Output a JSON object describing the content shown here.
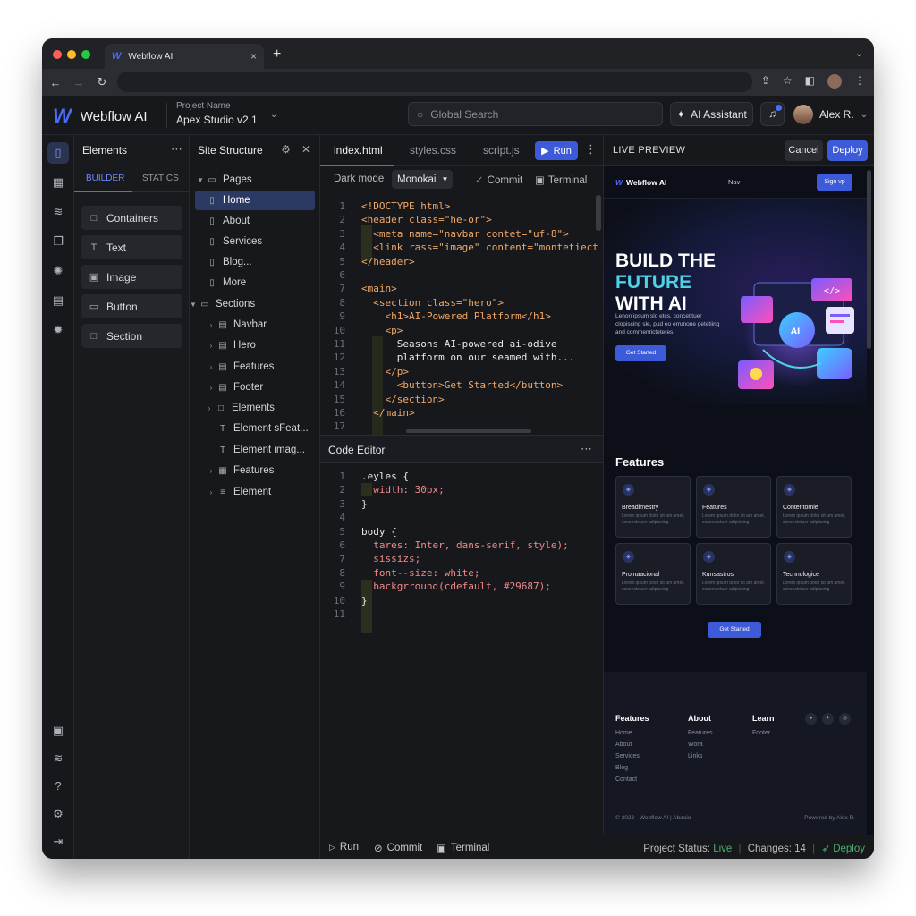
{
  "browser": {
    "tab_title": "Webflow AI",
    "tab_logo": "W",
    "tab_close": "×",
    "new_tab": "+"
  },
  "header": {
    "logo": "W",
    "app_name": "Webflow AI",
    "project_label": "Project Name",
    "project_name": "Apex Studio v2.1",
    "search_placeholder": "Global Search",
    "ai_assistant": "AI Assistant",
    "user_name": "Alex R."
  },
  "elements_panel": {
    "title": "Elements",
    "tabs": [
      "BUILDER",
      "STATICS"
    ],
    "items": [
      {
        "label": "Containers",
        "icon": "□"
      },
      {
        "label": "Text",
        "icon": "T"
      },
      {
        "label": "Image",
        "icon": "▣"
      },
      {
        "label": "Button",
        "icon": "▭"
      },
      {
        "label": "Section",
        "icon": "□"
      }
    ]
  },
  "site_structure": {
    "title": "Site Structure",
    "pages_label": "Pages",
    "pages": [
      "Home",
      "About",
      "Services",
      "Blog...",
      "More"
    ],
    "sections_label": "Sections",
    "sections": [
      "Navbar",
      "Hero",
      "Features",
      "Footer",
      "Elements",
      "Element sFeat...",
      "Element imag...",
      "Features",
      "Element"
    ]
  },
  "editor": {
    "tabs": [
      "index.html",
      "styles.css",
      "script.js"
    ],
    "run": "Run",
    "dark_mode": "Dark mode",
    "theme": "Monokai",
    "commit": "Commit",
    "terminal": "Terminal",
    "html_lines": [
      "<!DOCTYPE html>",
      "<header class=\"he-or\">",
      "  <meta name=\"navbar contet=\"uf-8\">",
      "  <link rass=\"image\" content=\"montetiect",
      "</header>",
      "",
      "<main>",
      "  <section class=\"hero\">",
      "    <h1>AI-Powered Platform</h1>",
      "    <p>",
      "      Seasons AI-powered ai-odive",
      "      platform on our seamed with...",
      "    </p>",
      "      <button>Get Started</button>",
      "    </section>",
      "  </main>",
      ""
    ],
    "code_editor_title": "Code Editor",
    "css_lines": [
      ".eyles {",
      "  width: 30px;",
      "}",
      "",
      "body {",
      "  tares: Inter, dans-serif, style);",
      "  sissizs;",
      "  font--size: white;",
      "  backgrround(cdefault, #29687);",
      "}",
      ""
    ]
  },
  "preview": {
    "title": "LIVE PREVIEW",
    "cancel": "Cancel",
    "deploy": "Deploy",
    "site_brand": "Webflow AI",
    "site_nav": "Nav",
    "site_signup": "Sign vp",
    "hero_line1": "BUILD THE",
    "hero_line2": "FUTURE",
    "hero_line3": "WITH AI",
    "hero_sub": "Lenon ipsum slo etcs, concetituer clopiscing sle, pud eo errunone getetiing and commenricteteres.",
    "hero_btn": "Get Started",
    "features_title": "Features",
    "cards": [
      {
        "name": "Breadimestry",
        "desc": "Lorem ipsum dolor sit am amet, consectetuer adipiscing"
      },
      {
        "name": "Features",
        "desc": "Lorem ipsum dolor sit am amet, consectetuer adipiscing"
      },
      {
        "name": "Contentomie",
        "desc": "Lorem ipsum dolor sit am amet, consectetuer adipiscing"
      },
      {
        "name": "Proinaacional",
        "desc": "Lorem ipsum dolor sit am amet, consectetuer adipiscing"
      },
      {
        "name": "Kunsastros",
        "desc": "Lorem ipsum dolor sit am amet, consectetuer adipiscing"
      },
      {
        "name": "Technologice",
        "desc": "Lorem ipsum dolor sit am amet, consectetuer adipiscing"
      }
    ],
    "features_btn": "Get Started",
    "footer_cols": [
      {
        "head": "Features",
        "links": [
          "Home",
          "About",
          "Services",
          "Blog",
          "Contact"
        ]
      },
      {
        "head": "About",
        "links": [
          "Features",
          "Wora",
          "Links"
        ]
      },
      {
        "head": "Learn",
        "links": [
          "Footer"
        ]
      }
    ],
    "copyright": "© 2023 - Webflow AI | Abaoio",
    "powered": "Powered by Alex R.",
    "help": "?"
  },
  "status_bar": {
    "run": "Run",
    "commit": "Commit",
    "terminal": "Terminal",
    "project_status_label": "Project Status:",
    "project_status": "Live",
    "changes_label": "Changes:",
    "changes": "14",
    "deploy": "Deploy"
  },
  "colors": {
    "accent": "#4b6cf7",
    "live": "#4caf6a",
    "hero_accent": "#4fd1e6"
  }
}
